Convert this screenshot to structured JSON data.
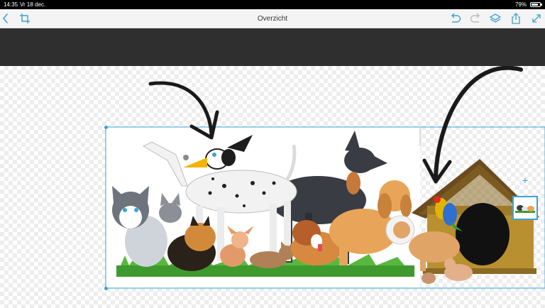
{
  "status_bar": {
    "time": "14:35",
    "date": "Vr 18 dec.",
    "battery_percent": "79%",
    "battery_level": 0.79
  },
  "toolbar": {
    "title": "Overzicht",
    "buttons": [
      "back-icon",
      "crop-icon",
      "undo-icon",
      "redo-icon",
      "layers-icon",
      "share-icon",
      "expand-icon"
    ]
  },
  "layers_panel": {
    "add_label": "+"
  },
  "colors": {
    "accent": "#3aa3d6",
    "toolbar_bg": "#f4f4f4",
    "dark_band": "#2f2f2f",
    "arrow": "#1a1a1a"
  }
}
